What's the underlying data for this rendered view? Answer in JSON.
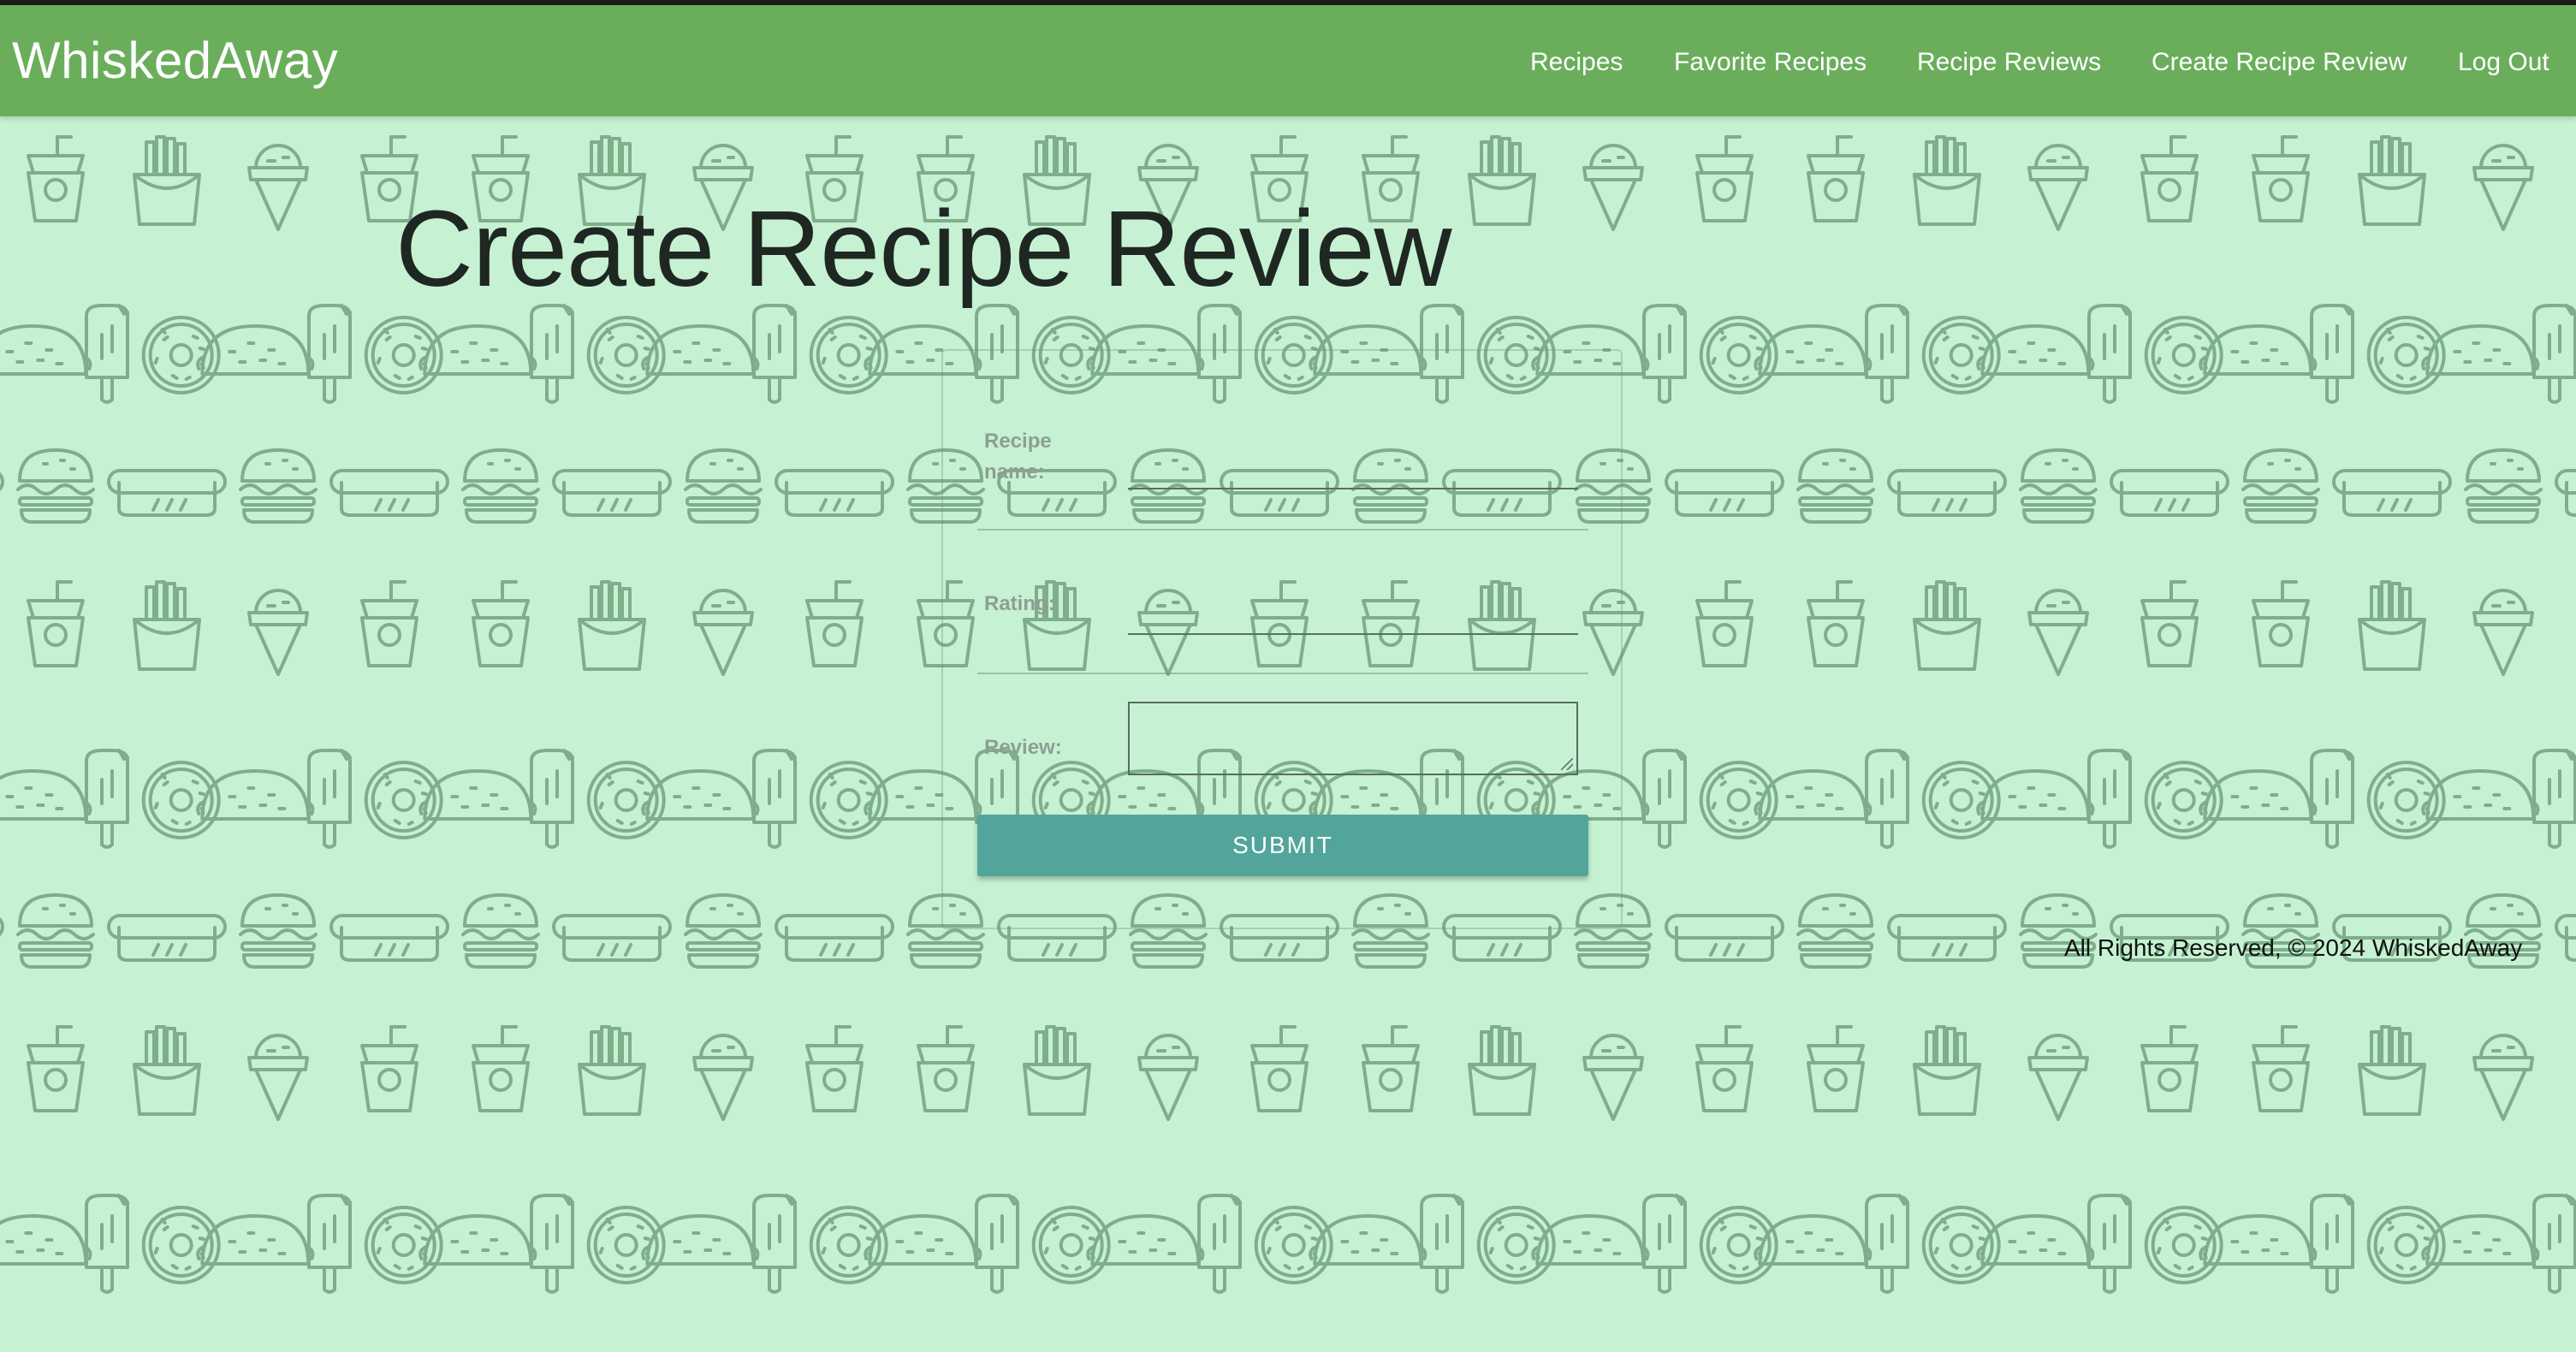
{
  "navbar": {
    "brand": "WhiskedAway",
    "links": [
      "Recipes",
      "Favorite Recipes",
      "Recipe Reviews",
      "Create Recipe Review",
      "Log Out"
    ]
  },
  "page": {
    "title": "Create Recipe Review"
  },
  "form": {
    "recipe_name_label_line1": "Recipe",
    "recipe_name_label_line2": "name:",
    "recipe_name_value": "",
    "rating_label": "Rating:",
    "rating_value": "",
    "review_label": "Review:",
    "review_value": "",
    "submit_label": "SUBMIT"
  },
  "footer": {
    "text": "All Rights Reserved, © 2024 WhiskedAway"
  },
  "colors": {
    "navbar_bg": "#6aae5c",
    "page_bg": "#c6f2d3",
    "pattern_stroke": "#7fae8b",
    "submit_bg": "#52a59b"
  },
  "background_pattern_icons": [
    "cup-icon",
    "fries-icon",
    "ice-cream-cone-icon",
    "popsicle-icon",
    "donut-icon",
    "taco-icon",
    "hotdog-icon",
    "burger-icon"
  ]
}
